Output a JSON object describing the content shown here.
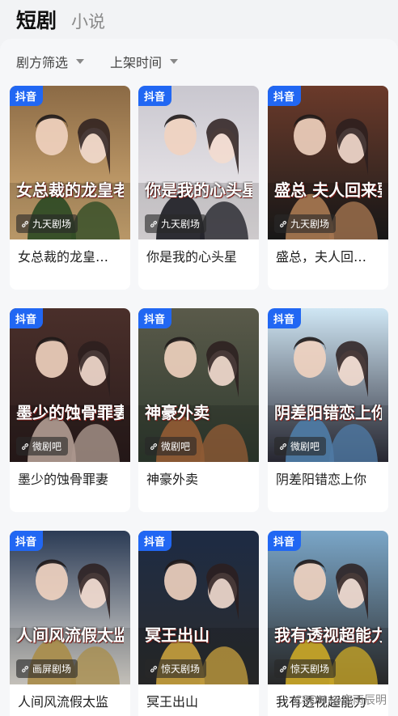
{
  "tabs": [
    {
      "label": "短剧"
    },
    {
      "label": "小说"
    }
  ],
  "filters": [
    {
      "label": "剧方筛选"
    },
    {
      "label": "上架时间"
    }
  ],
  "cards": [
    {
      "title": "女总裁的龙皇老公",
      "display_title": "女总裁的龙皇…",
      "platform": "抖音",
      "source": "九天剧场",
      "poster_text": "女总裁的龙皇老公",
      "palette": [
        "#8b6a45",
        "#3a5a2d",
        "#d9b27a"
      ]
    },
    {
      "title": "你是我的心头星",
      "display_title": "你是我的心头星",
      "platform": "抖音",
      "source": "九天剧场",
      "poster_text": "你是我的心头星",
      "palette": [
        "#c9c7cf",
        "#2b2b33",
        "#f2eef0"
      ]
    },
    {
      "title": "盛总，夫人回…",
      "display_title": "盛总，夫人回…",
      "platform": "抖音",
      "source": "九天剧场",
      "poster_text": "盛总 夫人回来要休你",
      "palette": [
        "#6b3a2a",
        "#c08a5e",
        "#1c1c1c"
      ]
    },
    {
      "title": "墨少的蚀骨罪妻",
      "display_title": "墨少的蚀骨罪妻",
      "platform": "抖音",
      "source": "微剧吧",
      "poster_text": "墨少的蚀骨罪妻",
      "palette": [
        "#4a2f2a",
        "#c9b2a6",
        "#2a1c1c"
      ]
    },
    {
      "title": "神豪外卖",
      "display_title": "神豪外卖",
      "platform": "抖音",
      "source": "微剧吧",
      "poster_text": "神豪外卖",
      "palette": [
        "#5a5a4a",
        "#a86a3e",
        "#2f3b2f"
      ]
    },
    {
      "title": "阴差阳错恋上你",
      "display_title": "阴差阳错恋上你",
      "platform": "抖音",
      "source": "微剧吧",
      "poster_text": "阴差阳错恋上你",
      "palette": [
        "#cfe6f4",
        "#5c8fc0",
        "#2e2e3a"
      ]
    },
    {
      "title": "人间风流假太监",
      "display_title": "人间风流假太监",
      "platform": "抖音",
      "source": "画屏剧场",
      "poster_text": "人间风流假太监",
      "palette": [
        "#2b3b55",
        "#c7a75c",
        "#e6e2da"
      ]
    },
    {
      "title": "冥王出山",
      "display_title": "冥王出山",
      "platform": "抖音",
      "source": "惊天剧场",
      "poster_text": "冥王出山",
      "palette": [
        "#1d2b44",
        "#e2b548",
        "#2d2d2d"
      ]
    },
    {
      "title": "我有透视超能力",
      "display_title": "我有透视超能力",
      "platform": "抖音",
      "source": "惊天剧场",
      "poster_text": "我有透视超能力",
      "palette": [
        "#7aa6c8",
        "#e8c12f",
        "#2f2f2f"
      ]
    }
  ],
  "watermark": "CSDN @夜雨辰明"
}
